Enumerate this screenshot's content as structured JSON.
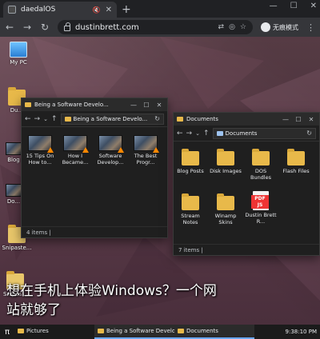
{
  "browser": {
    "tab_title": "daedalOS",
    "url": "dustinbrett.com",
    "profile_label": "无痕模式"
  },
  "desktop": {
    "icons": [
      {
        "label": "My PC"
      },
      {
        "label": "Du..."
      },
      {
        "label": "Blog"
      },
      {
        "label": "Do..."
      },
      {
        "label": "Snipaste..."
      },
      {
        "label": "Snipas..."
      }
    ]
  },
  "window1": {
    "title": "Being a Software Develo...",
    "address": "Being a Software Develo...",
    "items": [
      {
        "label": "15 Tips On How to..."
      },
      {
        "label": "How I Became..."
      },
      {
        "label": "Software Develop..."
      },
      {
        "label": "The Best Progr..."
      }
    ],
    "status": "4 items  |"
  },
  "window2": {
    "title": "Documents",
    "address": "Documents",
    "items": [
      {
        "label": "Blog Posts",
        "kind": "folder"
      },
      {
        "label": "Disk Images",
        "kind": "folder"
      },
      {
        "label": "DOS Bundles",
        "kind": "folder"
      },
      {
        "label": "Flash Files",
        "kind": "folder"
      },
      {
        "label": "Stream Notes",
        "kind": "folder"
      },
      {
        "label": "Winamp Skins",
        "kind": "folder"
      },
      {
        "label": "Dustin Brett R...",
        "kind": "pdf",
        "badge": "PDF JS"
      }
    ],
    "status": "7 items  |"
  },
  "caption": {
    "line1": "想在手机上体验Windows？一个网",
    "line2": "站就够了"
  },
  "taskbar": {
    "start_glyph": "π",
    "tasks": [
      {
        "label": "Pictures"
      },
      {
        "label": "Being a Software Develo..."
      },
      {
        "label": "Documents"
      }
    ],
    "time": "9:38:10 PM"
  }
}
